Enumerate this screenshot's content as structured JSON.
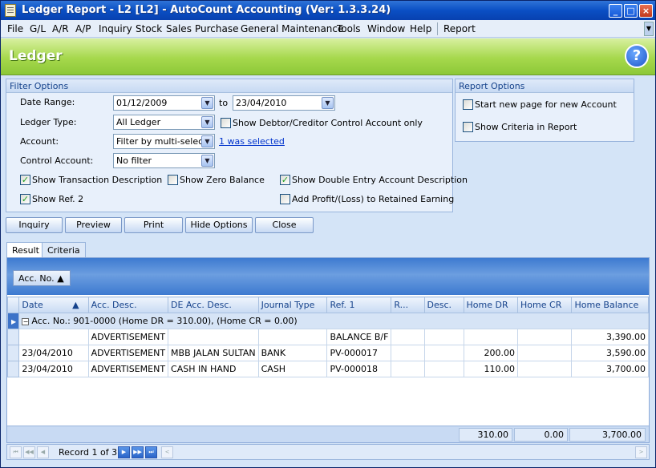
{
  "window": {
    "title": "Ledger Report - L2 [L2] - AutoCount Accounting (Ver: 1.3.3.24)"
  },
  "menu": [
    "File",
    "G/L",
    "A/R",
    "A/P",
    "Inquiry",
    "Stock",
    "Sales",
    "Purchase",
    "General Maintenance",
    "Tools",
    "Window",
    "Help",
    "Report"
  ],
  "header": {
    "title": "Ledger"
  },
  "filter": {
    "title": "Filter Options",
    "date_range_label": "Date Range:",
    "date_from": "01/12/2009",
    "to_label": "to",
    "date_to": "23/04/2010",
    "ledger_type_label": "Ledger Type:",
    "ledger_type": "All Ledger",
    "show_control_only": "Show Debtor/Creditor Control Account only",
    "account_label": "Account:",
    "account": "Filter by multi-select",
    "account_link": "1 was selected",
    "control_account_label": "Control Account:",
    "control_account": "No filter",
    "show_trans_desc": "Show Transaction Description",
    "show_zero_balance": "Show Zero Balance",
    "show_double_entry": "Show Double Entry Account Description",
    "show_ref2": "Show Ref. 2",
    "add_profit": "Add Profit/(Loss) to Retained Earning"
  },
  "report_options": {
    "title": "Report Options",
    "new_page": "Start new page for new Account",
    "show_criteria": "Show Criteria in Report"
  },
  "buttons": {
    "inquiry": "Inquiry",
    "preview": "Preview",
    "print": "Print",
    "hide": "Hide Options",
    "close": "Close"
  },
  "tabs": {
    "result": "Result",
    "criteria": "Criteria"
  },
  "grid": {
    "group_button": "Acc. No.",
    "columns": [
      "Date",
      "Acc. Desc.",
      "DE Acc. Desc.",
      "Journal Type",
      "Ref. 1",
      "R...",
      "Desc.",
      "Home DR",
      "Home CR",
      "Home Balance"
    ],
    "group_row": "Acc. No.: 901-0000 (Home DR = 310.00), (Home CR = 0.00)",
    "rows": [
      [
        "",
        "ADVERTISEMENT",
        "",
        "",
        "BALANCE B/F",
        "",
        "",
        "",
        "",
        "3,390.00"
      ],
      [
        "23/04/2010",
        "ADVERTISEMENT",
        "MBB JALAN SULTAN",
        "BANK",
        "PV-000017",
        "",
        "",
        "200.00",
        "",
        "3,590.00"
      ],
      [
        "23/04/2010",
        "ADVERTISEMENT",
        "CASH IN HAND",
        "CASH",
        "PV-000018",
        "",
        "",
        "110.00",
        "",
        "3,700.00"
      ]
    ],
    "totals": {
      "home_dr": "310.00",
      "home_cr": "0.00",
      "home_balance": "3,700.00"
    }
  },
  "nav": {
    "record": "Record 1 of 3"
  }
}
